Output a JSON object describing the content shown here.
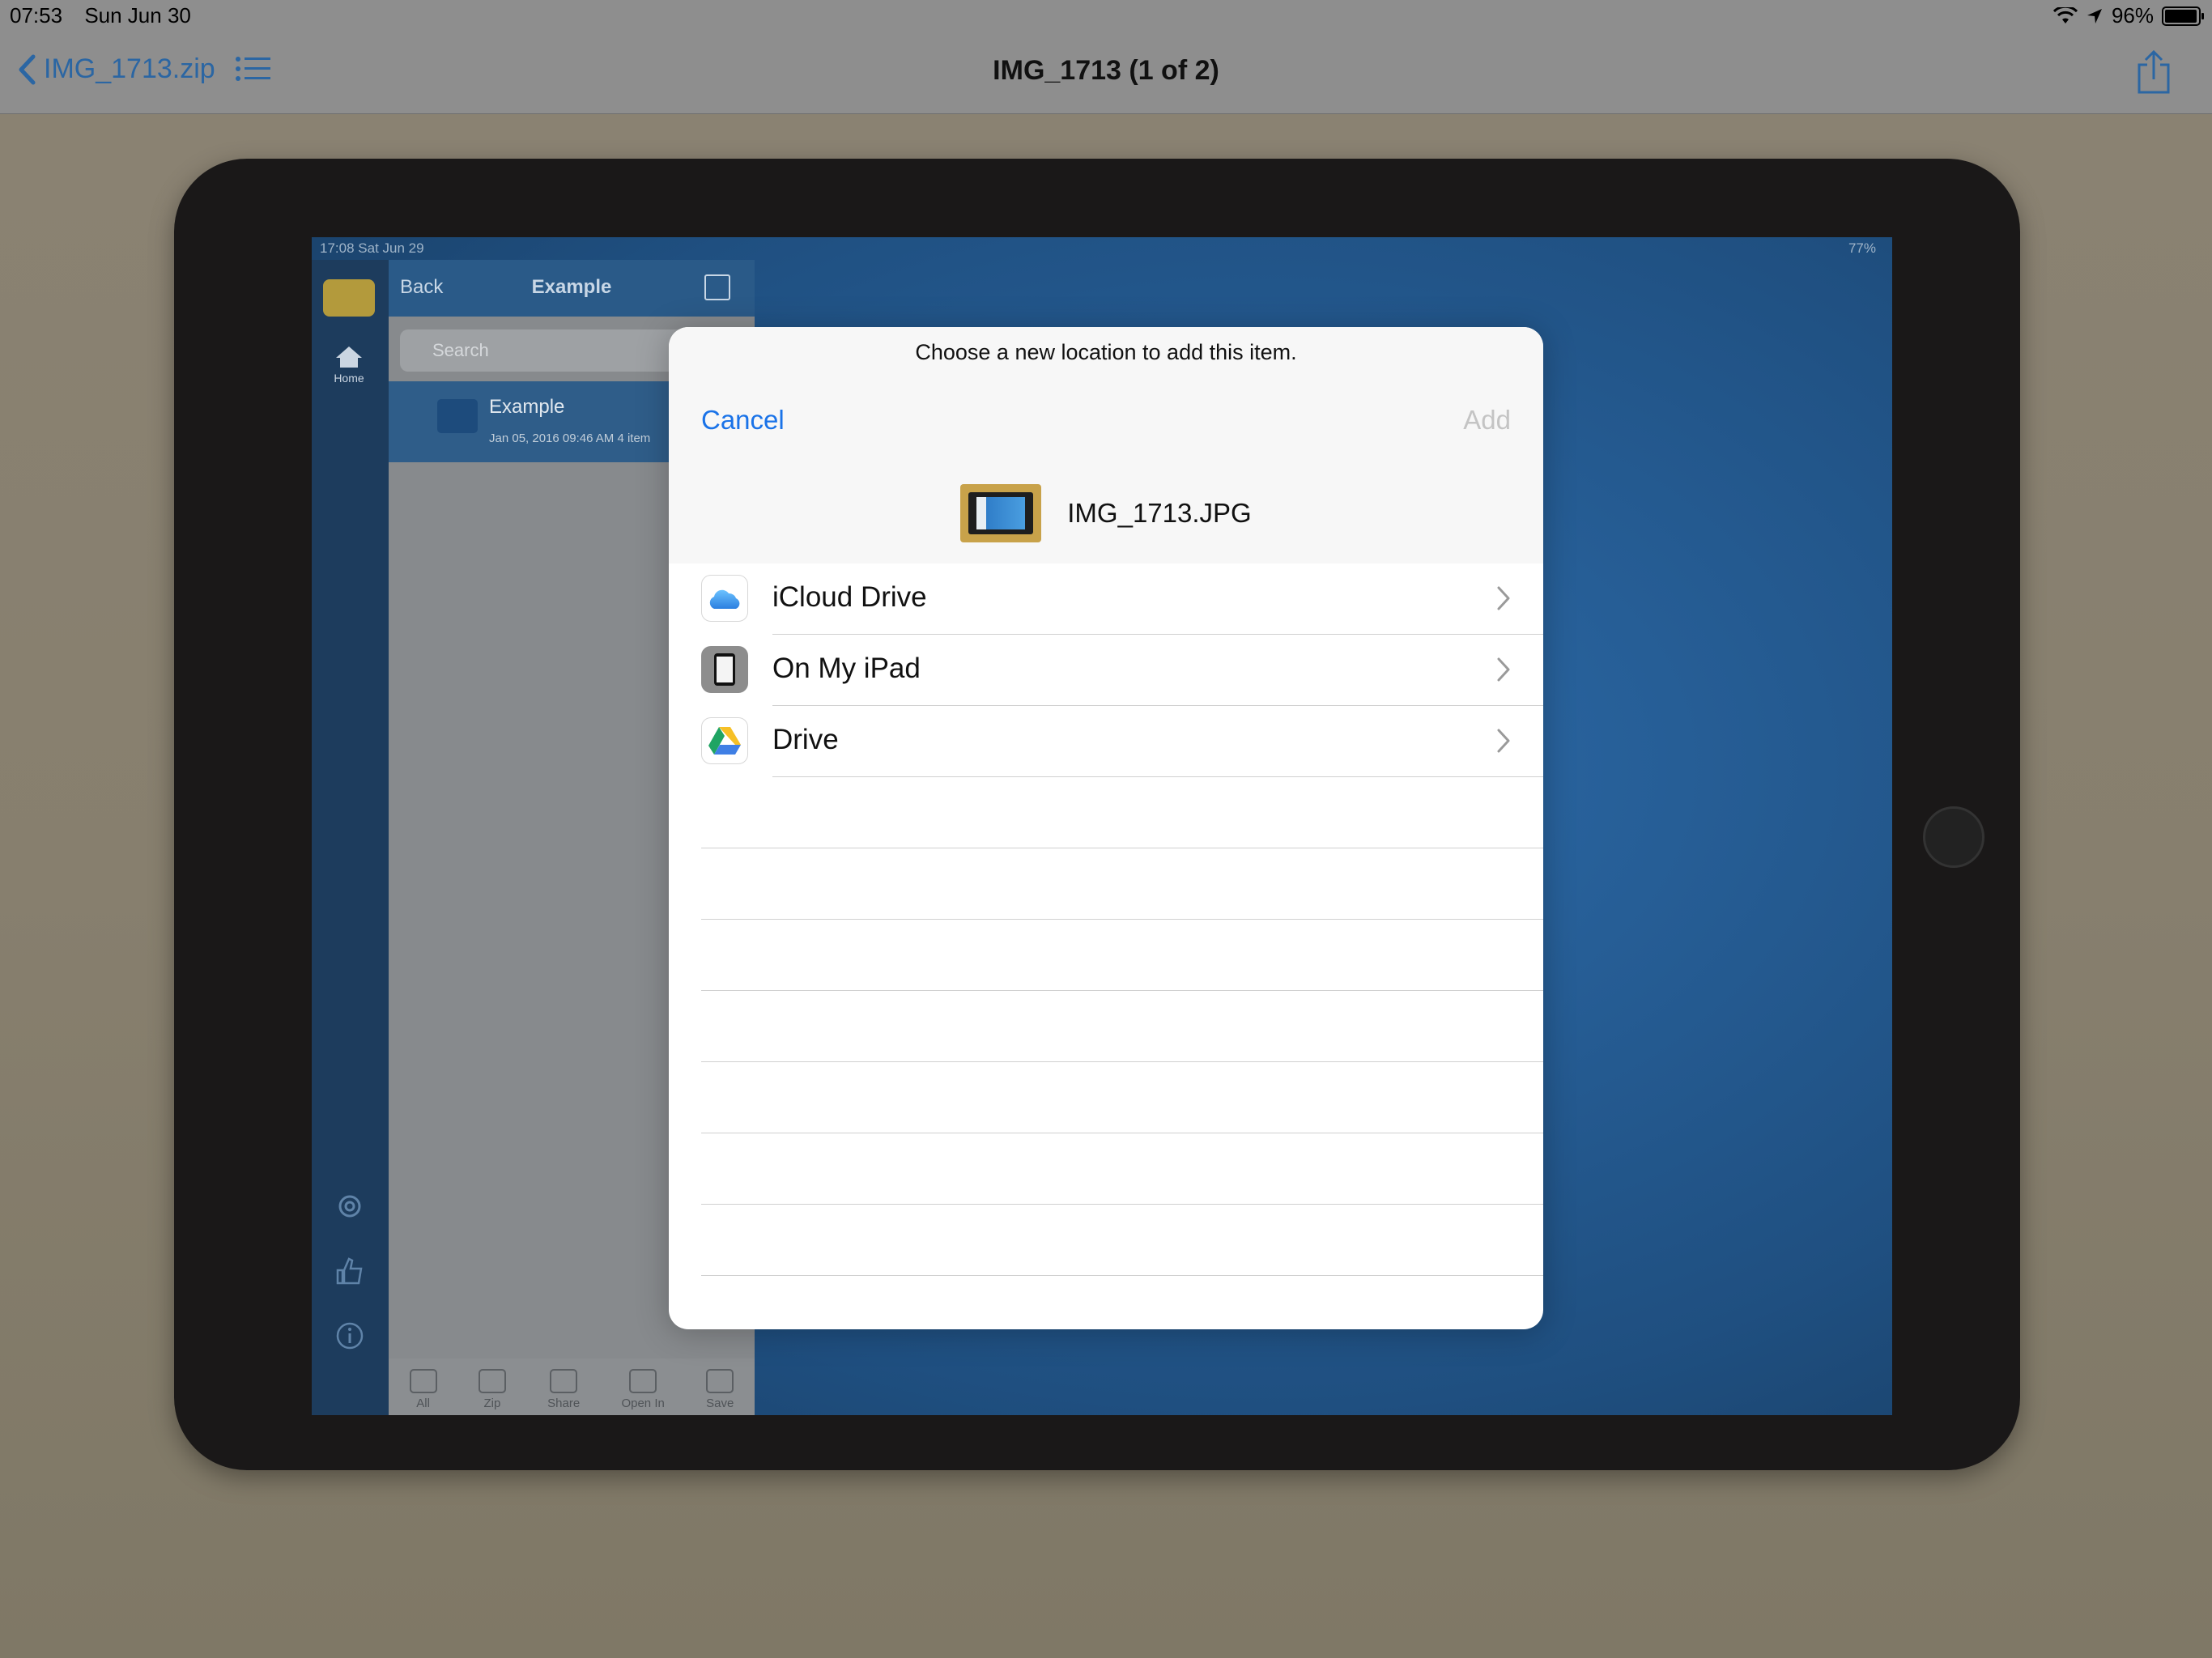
{
  "status_bar": {
    "time": "07:53",
    "date": "Sun Jun 30",
    "battery": "96%"
  },
  "nav": {
    "back_label": "IMG_1713.zip",
    "title": "IMG_1713 (1 of 2)"
  },
  "photo_device": {
    "status_time": "17:08",
    "status_date": "Sat Jun 29",
    "status_battery": "77%",
    "home_label": "Home",
    "back_label": "Back",
    "title": "Example",
    "search_placeholder": "Search",
    "row_name": "Example",
    "row_meta": "Jan 05, 2016 09:46 AM  4 item",
    "toolbar": [
      "All",
      "Zip",
      "Share",
      "Open In",
      "Save"
    ]
  },
  "modal": {
    "prompt": "Choose a new location to add this item.",
    "cancel_label": "Cancel",
    "add_label": "Add",
    "filename": "IMG_1713.JPG",
    "locations": [
      {
        "label": "iCloud Drive",
        "icon": "icloud-icon"
      },
      {
        "label": "On My iPad",
        "icon": "ipad-icon"
      },
      {
        "label": "Drive",
        "icon": "google-drive-icon"
      }
    ]
  },
  "colors": {
    "accent": "#1a73e8",
    "disabled": "#c4c4c4",
    "nav_link": "#2b66a3"
  }
}
